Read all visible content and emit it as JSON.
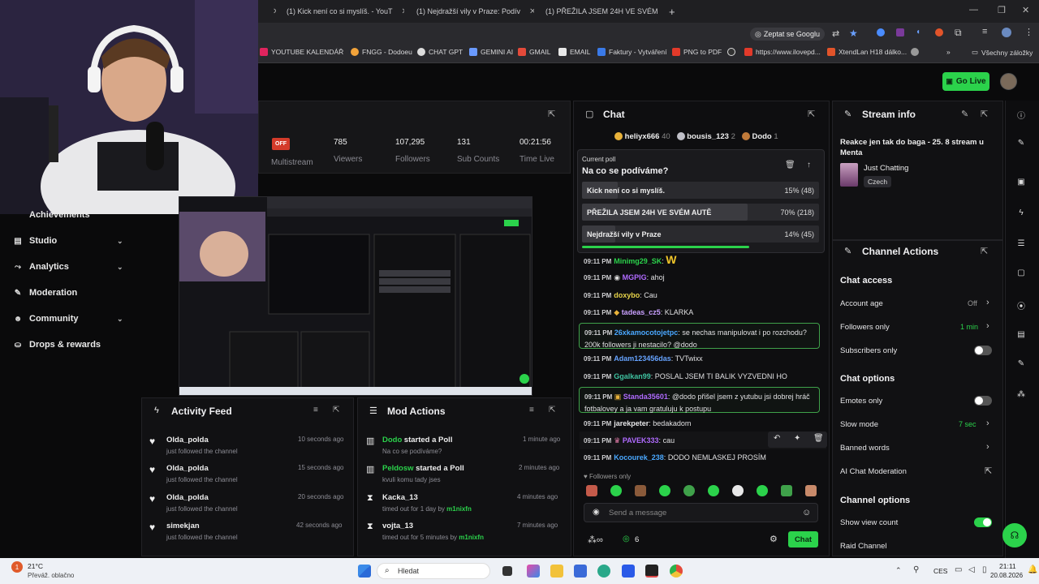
{
  "browser": {
    "tabs": [
      {
        "title": "(1) Kick není co si myslíš. - YouT"
      },
      {
        "title": "(1) Nejdražší vily v Praze: Podív"
      },
      {
        "title": "(1) PŘEŽILA JSEM 24H VE SVÉM"
      }
    ],
    "new_tab": "+",
    "ask_google": "Zeptat se Googlu",
    "bookmarks": [
      "YOUTUBE KALENDÁŘ",
      "FNGG - Dodoeu",
      "CHAT GPT",
      "GEMINI AI",
      "GMAIL",
      "EMAIL",
      "Faktury - Vytváření",
      "PNG to PDF",
      "https://www.ilovepd...",
      "XtendLan H18 dálko..."
    ],
    "all_bookmarks": "Všechny záložky"
  },
  "topbar": {
    "go_live": "Go Live"
  },
  "sidebar": {
    "items": [
      {
        "label": "Achievements"
      },
      {
        "label": "Studio"
      },
      {
        "label": "Analytics"
      },
      {
        "label": "Moderation"
      },
      {
        "label": "Community"
      },
      {
        "label": "Drops & rewards"
      }
    ]
  },
  "stats": {
    "status": "OFF",
    "multistream": "Multistream",
    "viewers": {
      "value": "785",
      "label": "Viewers"
    },
    "followers": {
      "value": "107,295",
      "label": "Followers"
    },
    "subs": {
      "value": "131",
      "label": "Sub Counts"
    },
    "time": {
      "value": "00:21:56",
      "label": "Time Live"
    }
  },
  "activity_feed": {
    "title": "Activity Feed",
    "items": [
      {
        "name": "Olda_polda",
        "text": "just followed the channel",
        "time": "10 seconds ago"
      },
      {
        "name": "Olda_polda",
        "text": "just followed the channel",
        "time": "15 seconds ago"
      },
      {
        "name": "Olda_polda",
        "text": "just followed the channel",
        "time": "20 seconds ago"
      },
      {
        "name": "simekjan",
        "text": "just followed the channel",
        "time": "42 seconds ago"
      }
    ]
  },
  "mod_actions": {
    "title": "Mod Actions",
    "items": [
      {
        "name": "Dodo",
        "action": "started a Poll",
        "text": "Na co se podíváme?",
        "time": "1 minute ago"
      },
      {
        "name": "Peldosw",
        "action": "started a Poll",
        "text": "kvuli komu tady jses",
        "time": "2 minutes ago"
      },
      {
        "name": "Kacka_13",
        "action": "",
        "text": "timed out for 1 day by",
        "by": "m1nixfn",
        "time": "4 minutes ago"
      },
      {
        "name": "vojta_13",
        "action": "",
        "text": "timed out for 5 minutes by",
        "by": "m1nixfn",
        "time": "7 minutes ago"
      }
    ]
  },
  "chat": {
    "title": "Chat",
    "leaders": [
      {
        "name": "heliyx666",
        "count": "40"
      },
      {
        "name": "bousis_123",
        "count": "2"
      },
      {
        "name": "Dodo",
        "count": "1"
      }
    ],
    "poll": {
      "label": "Current poll",
      "question": "Na co se podíváme?",
      "options": [
        {
          "text": "Kick není co si myslíš.",
          "pct": "15% (48)",
          "fraction": 0.15
        },
        {
          "text": "PŘEŽILA JSEM 24H VE SVÉM AUTĚ",
          "pct": "70% (218)",
          "fraction": 0.7
        },
        {
          "text": "Nejdražší vily v Praze",
          "pct": "14% (45)",
          "fraction": 0.14
        }
      ]
    },
    "messages": [
      {
        "time": "09:11 PM",
        "user": "Minimg29_SK",
        "text": "",
        "color": "#2bd24b"
      },
      {
        "time": "09:11 PM",
        "user": "MGPIG",
        "text": "ahoj",
        "color": "#b06bff"
      },
      {
        "time": "09:11 PM",
        "user": "doxybo",
        "text": "Cau",
        "color": "#e6d34a"
      },
      {
        "time": "09:11 PM",
        "user": "tadeas_cz5",
        "text": "KLARKA",
        "color": "#c9a0ff"
      },
      {
        "time": "09:11 PM",
        "user": "26xkamocotojetpc",
        "text": "se nechas manipulovat i po rozchodu? 200k followers ji nestacilo? @dodo",
        "color": "#4aa8ff"
      },
      {
        "time": "09:11 PM",
        "user": "Adam123456das",
        "text": "TVTwixx",
        "color": "#66a3ff"
      },
      {
        "time": "09:11 PM",
        "user": "Ggalkan99",
        "text": "POSLAL JSEM TI BALIK VYZVEDNI HO",
        "color": "#3fc2a0"
      },
      {
        "time": "09:11 PM",
        "user": "Standa35601",
        "text": "@dodo přišel jsem z yutubu jsi dobrej hráč fotbalovey a ja vam gratuluju k postupu",
        "color": "#b06bff"
      },
      {
        "time": "09:11 PM",
        "user": "jarekpeter",
        "text": "bedakadom",
        "color": "#e6e6e8"
      },
      {
        "time": "09:11 PM",
        "user": "PAVEK333",
        "text": "cau",
        "color": "#b06bff"
      },
      {
        "time": "09:11 PM",
        "user": "Kocourek_238",
        "text": "DODO NEMLASKEJ PROSÍM",
        "color": "#4aa8ff"
      }
    ],
    "followers_only": "Followers only",
    "input_placeholder": "Send a message",
    "points": "6",
    "send": "Chat"
  },
  "stream_info": {
    "title": "Stream info",
    "stream_title": "Reakce jen tak do baga - 25. 8 stream u Menta",
    "category": "Just Chatting",
    "language": "Czech"
  },
  "channel_actions": {
    "title": "Channel Actions",
    "chat_access": "Chat access",
    "account_age": {
      "label": "Account age",
      "value": "Off"
    },
    "followers_only": {
      "label": "Followers only",
      "value": "1 min"
    },
    "subscribers_only": {
      "label": "Subscribers only"
    },
    "chat_options": "Chat options",
    "emotes_only": {
      "label": "Emotes only"
    },
    "slow_mode": {
      "label": "Slow mode",
      "value": "7 sec"
    },
    "banned_words": {
      "label": "Banned words"
    },
    "ai_moderation": {
      "label": "AI Chat Moderation"
    },
    "channel_options": "Channel options",
    "show_view_count": {
      "label": "Show view count"
    },
    "raid_channel": {
      "label": "Raid Channel"
    }
  },
  "taskbar": {
    "weather_temp": "21°C",
    "weather_text": "Převáž. oblačno",
    "search": "Hledat",
    "lang": "CES",
    "time": "21:11",
    "date": "20.08.2026",
    "badge": "1"
  },
  "colors": {
    "accent": "#2bd24b",
    "bg": "#0a0a0b",
    "panel": "#111113"
  }
}
